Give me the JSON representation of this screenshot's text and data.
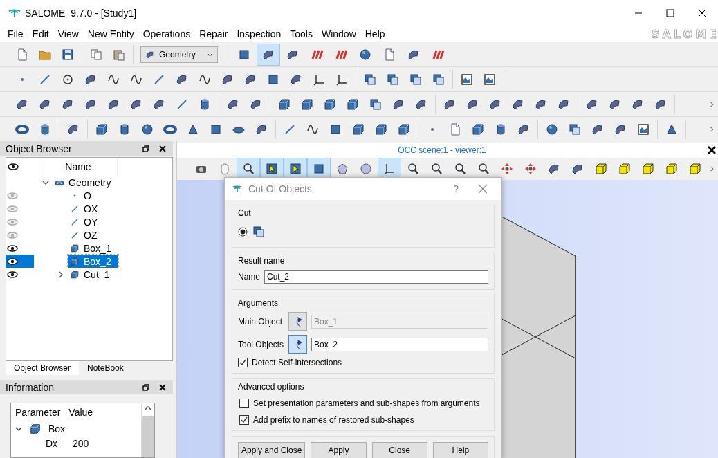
{
  "window": {
    "title": "SALOME  9.7.0 - [Study1]"
  },
  "menu": [
    "File",
    "Edit",
    "View",
    "New Entity",
    "Operations",
    "Repair",
    "Inspection",
    "Tools",
    "Window",
    "Help"
  ],
  "brand_logo": "SALOME",
  "module_selector": {
    "value": "Geometry"
  },
  "module_buttons": [
    {
      "selected": false
    },
    {
      "selected": true
    },
    {
      "selected": false
    },
    {
      "selected": false
    },
    {
      "selected": false
    },
    {
      "selected": false
    },
    {
      "selected": false
    },
    {
      "selected": false
    },
    {
      "selected": false
    }
  ],
  "object_browser": {
    "title": "Object Browser",
    "column": "Name",
    "tree": [
      {
        "name": "Geometry",
        "kind": "module",
        "expanded": true,
        "selected": false,
        "children": [
          {
            "name": "O",
            "kind": "point",
            "visible": false,
            "selected": false
          },
          {
            "name": "OX",
            "kind": "line",
            "visible": false,
            "selected": false
          },
          {
            "name": "OY",
            "kind": "line",
            "visible": false,
            "selected": false
          },
          {
            "name": "OZ",
            "kind": "line",
            "visible": false,
            "selected": false
          },
          {
            "name": "Box_1",
            "kind": "box",
            "visible": true,
            "selected": false
          },
          {
            "name": "Box_2",
            "kind": "box",
            "visible": true,
            "selected": true
          },
          {
            "name": "Cut_1",
            "kind": "box",
            "visible": true,
            "selected": false,
            "expanded": false
          }
        ]
      }
    ]
  },
  "left_tabs": [
    {
      "label": "Object Browser",
      "selected": true
    },
    {
      "label": "NoteBook",
      "selected": false
    }
  ],
  "information": {
    "title": "Information",
    "columns": [
      "Parameter",
      "Value"
    ],
    "rows": [
      {
        "name": "Box",
        "expanded": true,
        "children": [
          {
            "name": "Dx",
            "value": "200"
          }
        ]
      }
    ]
  },
  "viewer": {
    "title": "OCC scene:1 - viewer:1",
    "toolbar": [
      {
        "on": false
      },
      {
        "on": false
      },
      {
        "on": true
      },
      {
        "on": true
      },
      {
        "on": true
      },
      {
        "on": true
      },
      {
        "on": false
      },
      {
        "on": false
      },
      {
        "on": true
      },
      {
        "on": false
      },
      {
        "on": false
      },
      {
        "on": false
      },
      {
        "on": false
      },
      {
        "on": false
      },
      {
        "on": false
      },
      {
        "on": false
      },
      {
        "on": false
      },
      {
        "on": false
      },
      {
        "on": false
      },
      {
        "on": false
      },
      {
        "on": false
      },
      {
        "on": false
      }
    ]
  },
  "dialog": {
    "title": "Cut Of Objects",
    "help_button": "?",
    "cut": {
      "title": "Cut",
      "options": [
        {
          "selected": true
        }
      ]
    },
    "result": {
      "title": "Result name",
      "label": "Name",
      "value": "Cut_2"
    },
    "arguments": {
      "title": "Arguments",
      "fields": [
        {
          "label": "Main Object",
          "value": "Box_1",
          "disabled": true,
          "selected": false
        },
        {
          "label": "Tool Objects",
          "value": "Box_2",
          "disabled": false,
          "selected": true
        }
      ],
      "checkbox": {
        "label": "Detect Self-intersections",
        "checked": true
      }
    },
    "advanced": {
      "title": "Advanced options",
      "options": [
        {
          "label": "Set presentation parameters and sub-shapes from arguments",
          "checked": false
        },
        {
          "label": "Add prefix to names of restored sub-shapes",
          "checked": true
        }
      ]
    },
    "buttons": [
      "Apply and Close",
      "Apply",
      "Close",
      "Help"
    ]
  }
}
